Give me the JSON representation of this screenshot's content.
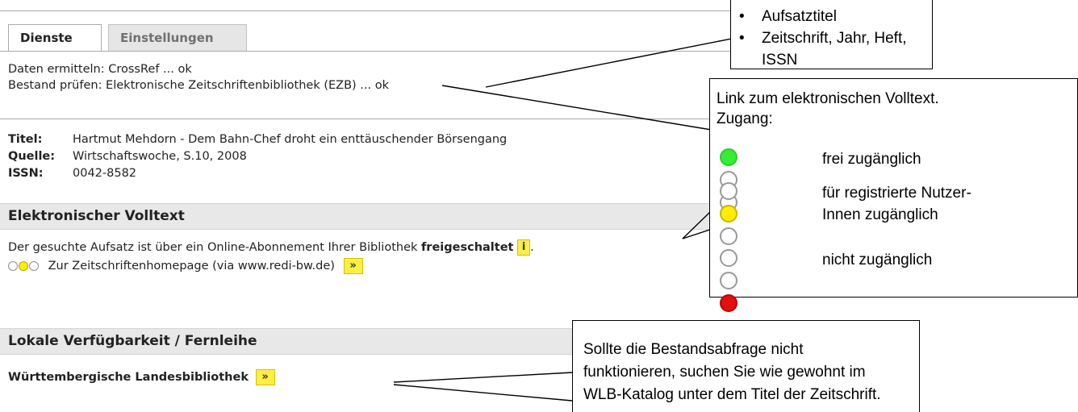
{
  "tabs": {
    "services": "Dienste",
    "settings": "Einstellungen"
  },
  "status": {
    "line1": "Daten ermitteln: CrossRef ... ok",
    "line2": "Bestand prüfen: Elektronische Zeitschriftenbibliothek (EZB) ... ok"
  },
  "meta": {
    "title_label": "Titel:",
    "title_value": "Hartmut Mehdorn - Dem Bahn-Chef droht ein enttäuschender Börsengang",
    "source_label": "Quelle:",
    "source_value": "Wirtschaftswoche, S.10, 2008",
    "issn_label": "ISSN:",
    "issn_value": "0042-8582"
  },
  "fulltext": {
    "heading": "Elektronischer Volltext",
    "text_before": "Der gesuchte Aufsatz ist über ein Online-Abonnement Ihrer Bibliothek ",
    "text_bold": "freigeschaltet",
    "info_button": "i",
    "after_info": ".",
    "link_text": "Zur Zeitschriftenhomepage (via www.redi-bw.de)",
    "go_button": "»",
    "lights": [
      "off",
      "yellow",
      "off"
    ]
  },
  "local": {
    "heading": "Lokale Verfügbarkeit / Fernleihe",
    "library": "Württembergische Landesbibliothek",
    "go_button": "»"
  },
  "callouts": {
    "top_items": [
      "Aufsatztitel",
      "Zeitschrift, Jahr, Heft, ISSN"
    ],
    "legend_title_1": "Link zum elektronischen Volltext.",
    "legend_title_2": "Zugang:",
    "legend": [
      {
        "lights": [
          "green",
          "off",
          "off"
        ],
        "line1": "frei zugänglich",
        "line2": ""
      },
      {
        "lights": [
          "off",
          "yellow",
          "off"
        ],
        "line1": "für registrierte Nutzer-",
        "line2": "Innen zugänglich"
      },
      {
        "lights": [
          "off",
          "off",
          "red"
        ],
        "line1": "nicht zugänglich",
        "line2": ""
      }
    ],
    "bottom_lines": [
      "Sollte die Bestandsabfrage nicht",
      "funktionieren, suchen Sie wie gewohnt im",
      "WLB-Katalog unter dem Titel der Zeitschrift."
    ]
  },
  "colors": {
    "accent_yellow": "#ffee44",
    "light_green": "#33dd33",
    "light_red": "#e41010",
    "section_bg": "#e8e8e8"
  }
}
